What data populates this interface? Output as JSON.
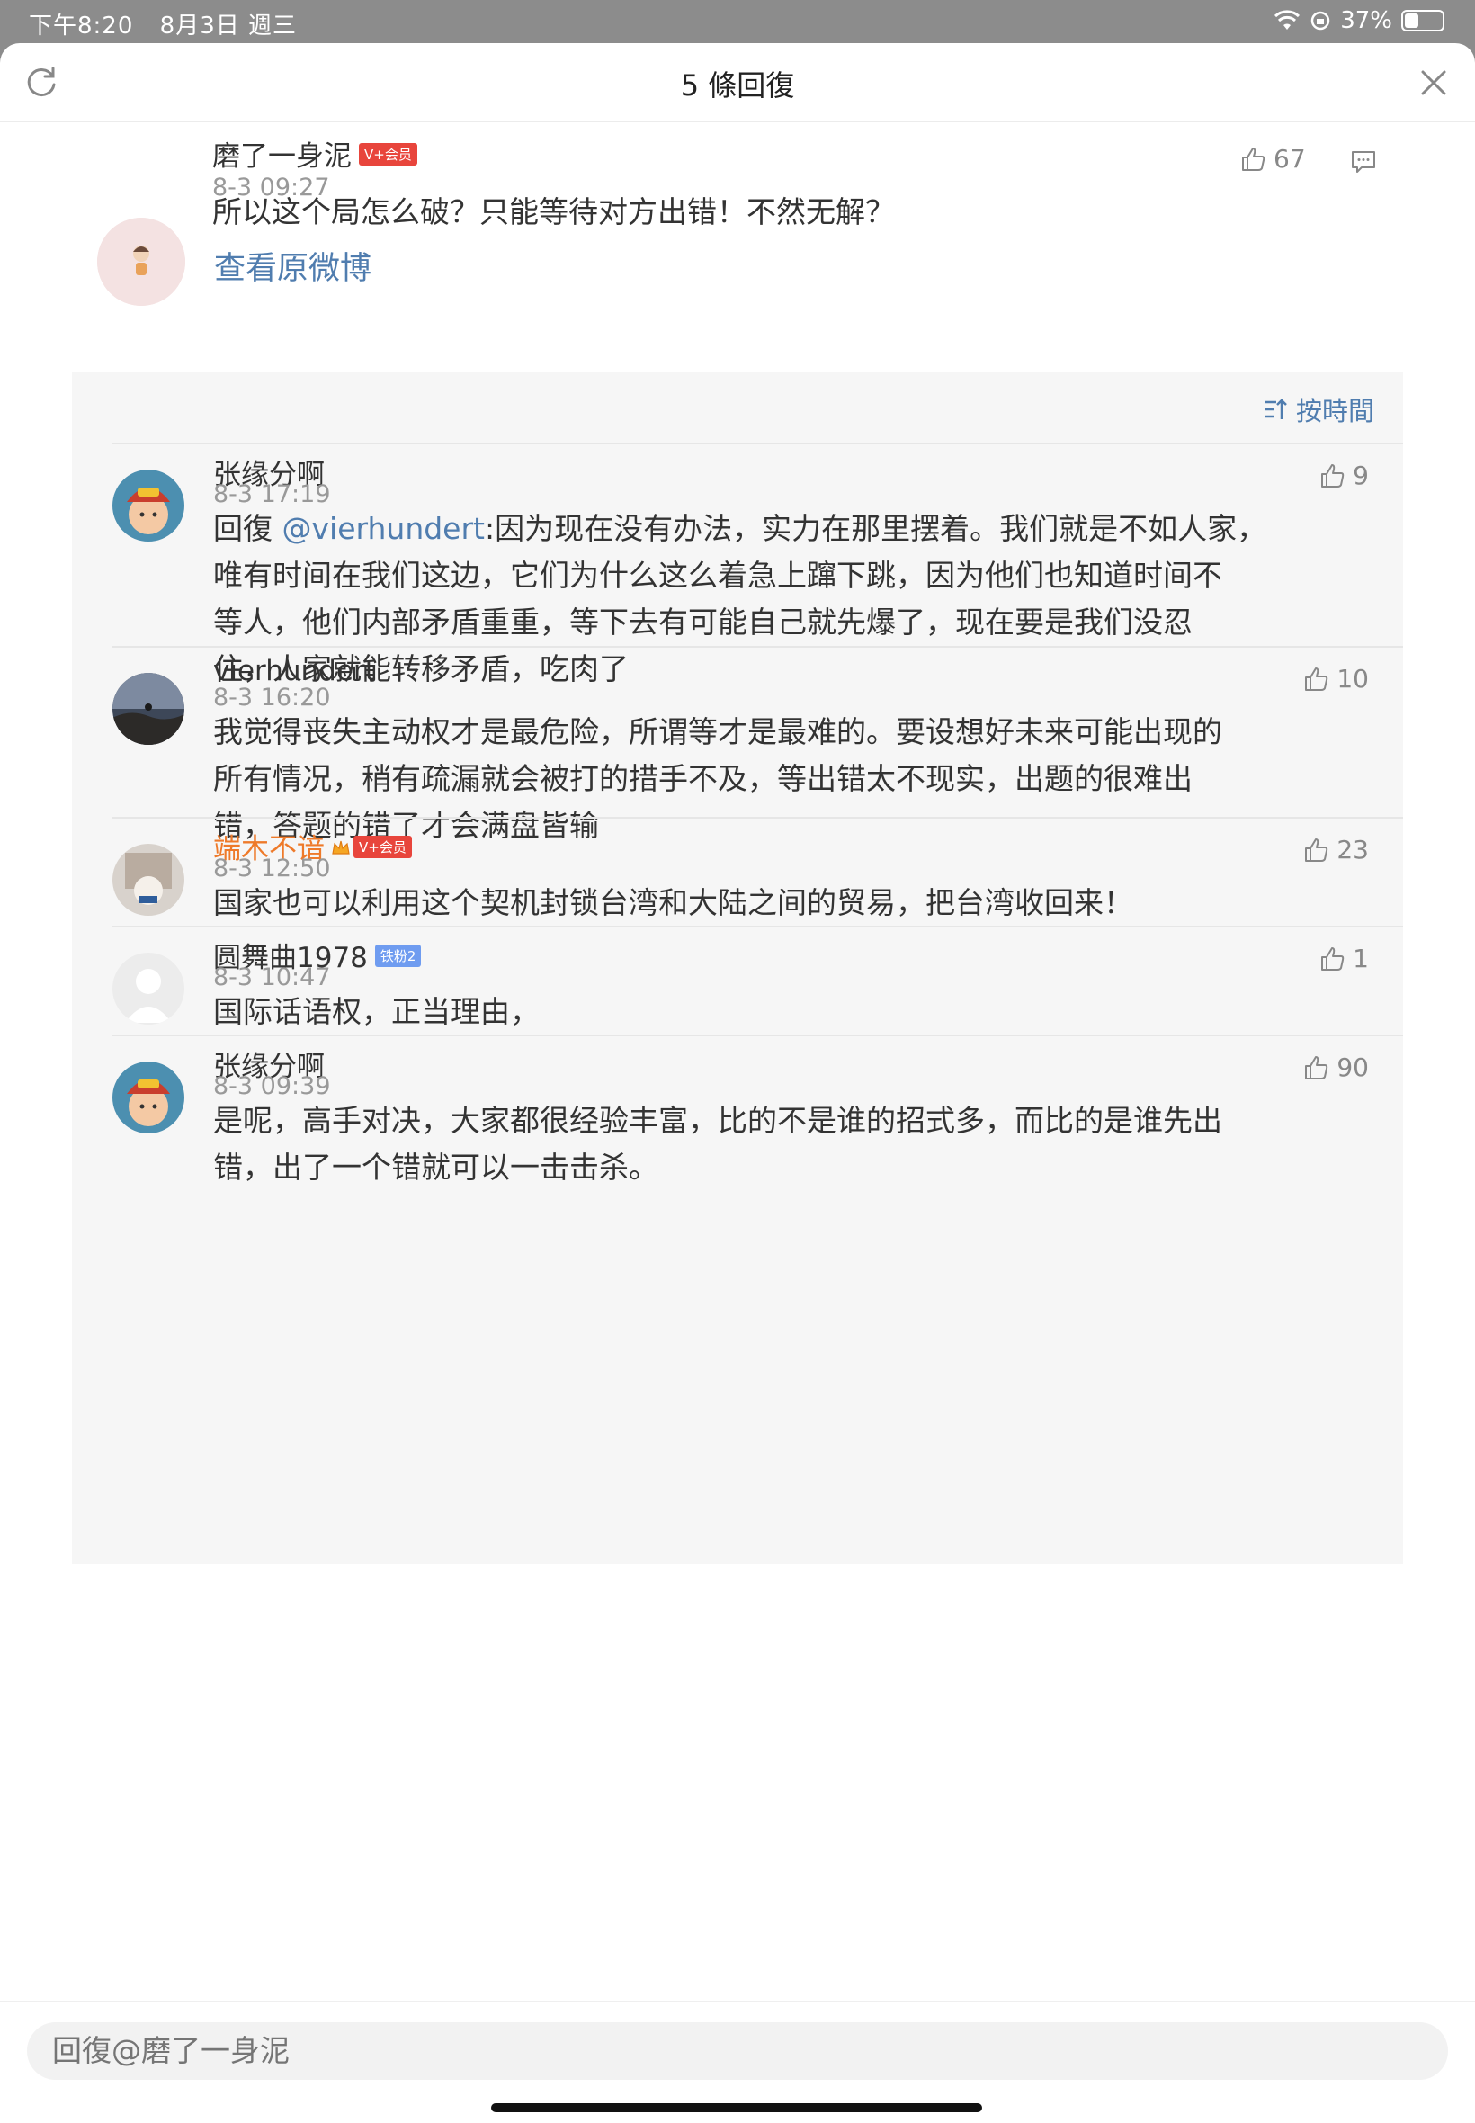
{
  "status_bar": {
    "time": "下午8:20",
    "date": "8月3日 週三",
    "battery": "37%",
    "battery_level": 0.37
  },
  "header": {
    "title": "5 條回復"
  },
  "root_comment": {
    "username": "磨了一身泥",
    "badge": "V+会员",
    "time": "8-3 09:27",
    "text": "所以这个局怎么破？只能等待对方出错！不然无解？",
    "likes": "67",
    "view_original": "查看原微博"
  },
  "sort_label": "按時間",
  "replies": [
    {
      "username": "张缘分啊",
      "time": "8-3 17:19",
      "likes": "9",
      "reply_prefix": "回復 ",
      "mention": "@vierhundert",
      "text_lines": [
        ":因为现在没有办法，实力在那里摆着。我们就是不如人家，",
        "唯有时间在我们这边，它们为什么这么着急上蹿下跳，因为他们也知道时间不",
        "等人，他们内部矛盾重重，等下去有可能自己就先爆了，现在要是我们没忍",
        "住，人家就能转移矛盾，吃肉了"
      ]
    },
    {
      "username": "vierhundert",
      "time": "8-3 16:20",
      "likes": "10",
      "text_lines": [
        "我觉得丧失主动权才是最危险，所谓等才是最难的。要设想好未来可能出现的",
        "所有情况，稍有疏漏就会被打的措手不及，等出错太不现实，出题的很难出",
        "错，答题的错了才会满盘皆输"
      ]
    },
    {
      "username": "端木不谙",
      "badge": "V+会员",
      "time": "8-3 12:50",
      "likes": "23",
      "text_lines": [
        "国家也可以利用这个契机封锁台湾和大陆之间的贸易，把台湾收回来！"
      ]
    },
    {
      "username": "圆舞曲1978",
      "badge": "铁粉2",
      "time": "8-3 10:47",
      "likes": "1",
      "text_lines": [
        "国际话语权，正当理由，"
      ]
    },
    {
      "username": "张缘分啊",
      "time": "8-3 09:39",
      "likes": "90",
      "text_lines": [
        "是呢，高手对决，大家都很经验丰富，比的不是谁的招式多，而比的是谁先出",
        "错，出了一个错就可以一击击杀。"
      ]
    }
  ],
  "input": {
    "placeholder": "回復@磨了一身泥"
  },
  "colors": {
    "link": "#507daf",
    "vip_name": "#ee7a2a",
    "panel_bg": "#f6f6f6"
  }
}
